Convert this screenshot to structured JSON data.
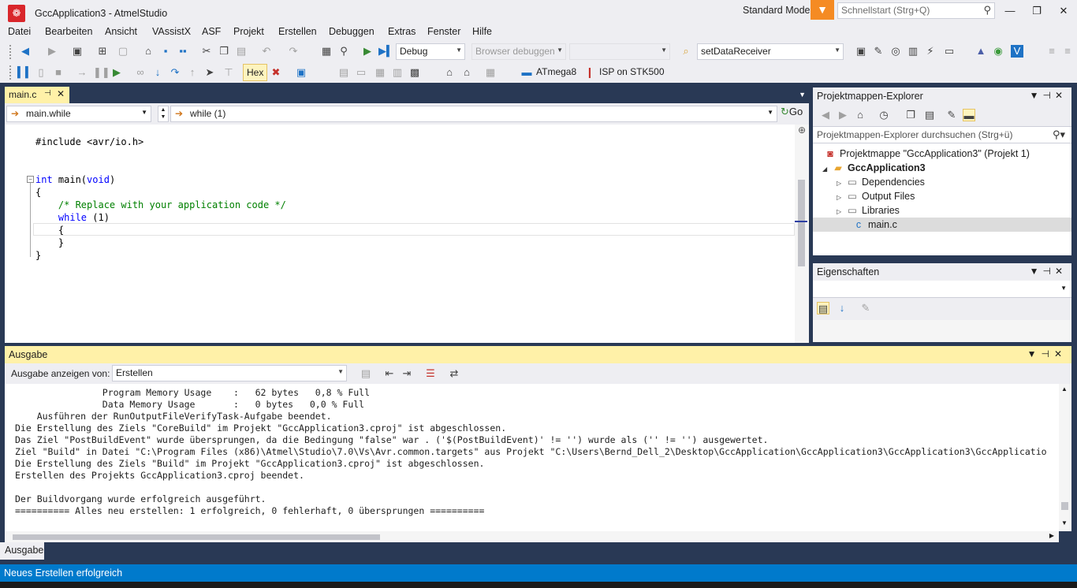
{
  "window": {
    "title": "GccApplication3 - AtmelStudio",
    "mode": "Standard Mode",
    "quick_launch_placeholder": "Schnellstart (Strg+Q)",
    "minimize": "—",
    "maximize": "❐",
    "close": "✕"
  },
  "menu": [
    "Datei",
    "Bearbeiten",
    "Ansicht",
    "VAssistX",
    "ASF",
    "Projekt",
    "Erstellen",
    "Debuggen",
    "Extras",
    "Fenster",
    "Hilfe"
  ],
  "toolbar": {
    "config": "Debug",
    "browser": "Browser debuggen",
    "find_combo": "setDataReceiver",
    "hex_label": "Hex",
    "device": "ATmega8",
    "tool": "ISP on STK500"
  },
  "editor": {
    "tab_label": "main.c",
    "nav_left": "main.while",
    "nav_right": "while (1)",
    "go_label": "Go",
    "code": {
      "l1_pre": "#include <avr/io.h>",
      "l2_kw": "int",
      "l2_a": " main(",
      "l2_kw2": "void",
      "l2_b": ")",
      "l3": "{",
      "l4_cm": "    /* Replace with your application code */",
      "l5_kw": "    while",
      "l5_rest": " (1)",
      "l6": "    {",
      "l7": "    }",
      "l8": "}"
    }
  },
  "solution_explorer": {
    "title": "Projektmappen-Explorer",
    "search_placeholder": "Projektmappen-Explorer durchsuchen (Strg+ü)",
    "solution": "Projektmappe \"GccApplication3\" (Projekt 1)",
    "project": "GccApplication3",
    "items": [
      "Dependencies",
      "Output Files",
      "Libraries"
    ],
    "file": "main.c"
  },
  "properties": {
    "title": "Eigenschaften"
  },
  "output": {
    "title": "Ausgabe",
    "show_from_label": "Ausgabe anzeigen von:",
    "source": "Erstellen",
    "lines": [
      "                Program Memory Usage    :   62 bytes   0,8 % Full",
      "                Data Memory Usage       :   0 bytes   0,0 % Full",
      "    Ausführen der RunOutputFileVerifyTask-Aufgabe beendet.",
      "Die Erstellung des Ziels \"CoreBuild\" im Projekt \"GccApplication3.cproj\" ist abgeschlossen.",
      "Das Ziel \"PostBuildEvent\" wurde übersprungen, da die Bedingung \"false\" war . ('$(PostBuildEvent)' != '') wurde als ('' != '') ausgewertet.",
      "Ziel \"Build\" in Datei \"C:\\Program Files (x86)\\Atmel\\Studio\\7.0\\Vs\\Avr.common.targets\" aus Projekt \"C:\\Users\\Bernd_Dell_2\\Desktop\\GccApplication\\GccApplication3\\GccApplication3\\GccApplicatio",
      "Die Erstellung des Ziels \"Build\" im Projekt \"GccApplication3.cproj\" ist abgeschlossen.",
      "Erstellen des Projekts GccApplication3.cproj beendet.",
      "",
      "Der Buildvorgang wurde erfolgreich ausgeführt.",
      "========== Alles neu erstellen: 1 erfolgreich, 0 fehlerhaft, 0 übersprungen =========="
    ],
    "bottom_tab": "Ausgabe"
  },
  "status": {
    "text": "Neues Erstellen erfolgreich"
  }
}
